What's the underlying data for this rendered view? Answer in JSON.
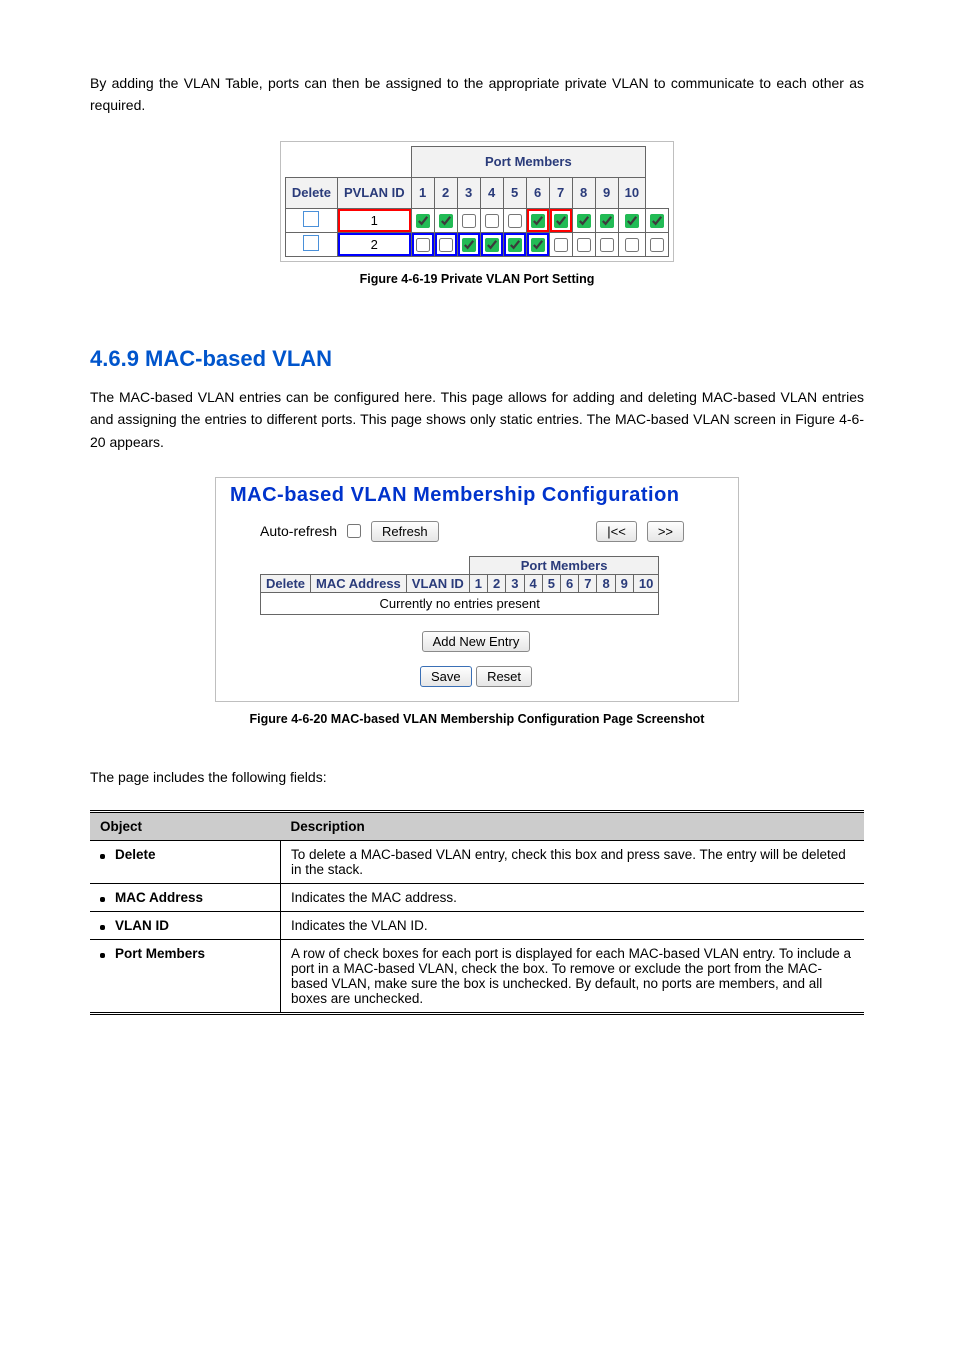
{
  "intro_para": "By adding the VLAN Table, ports can then be assigned to the appropriate private VLAN to communicate to each other as required.",
  "figure1": {
    "group_header": "Port Members",
    "columns": [
      "Delete",
      "PVLAN ID",
      "1",
      "2",
      "3",
      "4",
      "5",
      "6",
      "7",
      "8",
      "9",
      "10"
    ],
    "rows": [
      {
        "id": "1",
        "members": [
          true,
          true,
          false,
          false,
          false,
          true,
          true,
          true,
          true,
          true,
          true
        ]
      },
      {
        "id": "2",
        "members": [
          false,
          false,
          true,
          true,
          true,
          true,
          false,
          false,
          false,
          false,
          false
        ]
      }
    ],
    "highlight_red": [
      0,
      5,
      6
    ],
    "highlight_blue": [
      5,
      6
    ]
  },
  "figure1_caption": "Figure 4-6-19 Private VLAN Port Setting",
  "section_heading": "4.6.9 MAC-based VLAN",
  "section_para1": "The MAC-based VLAN entries can be configured here. This page allows for adding and deleting MAC-based VLAN entries and assigning the entries to different ports. This page shows only static entries. The MAC-based VLAN screen in Figure 4-6-20 appears.",
  "figure2": {
    "title": "MAC-based VLAN Membership Configuration",
    "auto_refresh_label": "Auto-refresh",
    "refresh_btn": "Refresh",
    "prev_btn": "|<<",
    "next_btn": ">>",
    "group_header": "Port Members",
    "columns": [
      "Delete",
      "MAC Address",
      "VLAN ID",
      "1",
      "2",
      "3",
      "4",
      "5",
      "6",
      "7",
      "8",
      "9",
      "10"
    ],
    "empty_msg": "Currently no entries present",
    "add_btn": "Add New Entry",
    "save_btn": "Save",
    "reset_btn": "Reset"
  },
  "figure2_caption": "Figure 4-6-20 MAC-based VLAN Membership Configuration Page Screenshot",
  "table_intro": "The page includes the following fields:",
  "param_headers": [
    "Object",
    "Description"
  ],
  "params": [
    {
      "obj": "Delete",
      "desc": "To delete a MAC-based VLAN entry, check this box and press save. The entry will be deleted in the stack."
    },
    {
      "obj": "MAC Address",
      "desc": "Indicates the MAC address."
    },
    {
      "obj": "VLAN ID",
      "desc": "Indicates the VLAN ID."
    },
    {
      "obj": "Port Members",
      "desc": "A row of check boxes for each port is displayed for each MAC-based VLAN entry. To include a port in a MAC-based VLAN, check the box. To remove or exclude the port from the MAC-based VLAN, make sure the box is unchecked. By default, no ports are members, and all boxes are unchecked."
    }
  ]
}
